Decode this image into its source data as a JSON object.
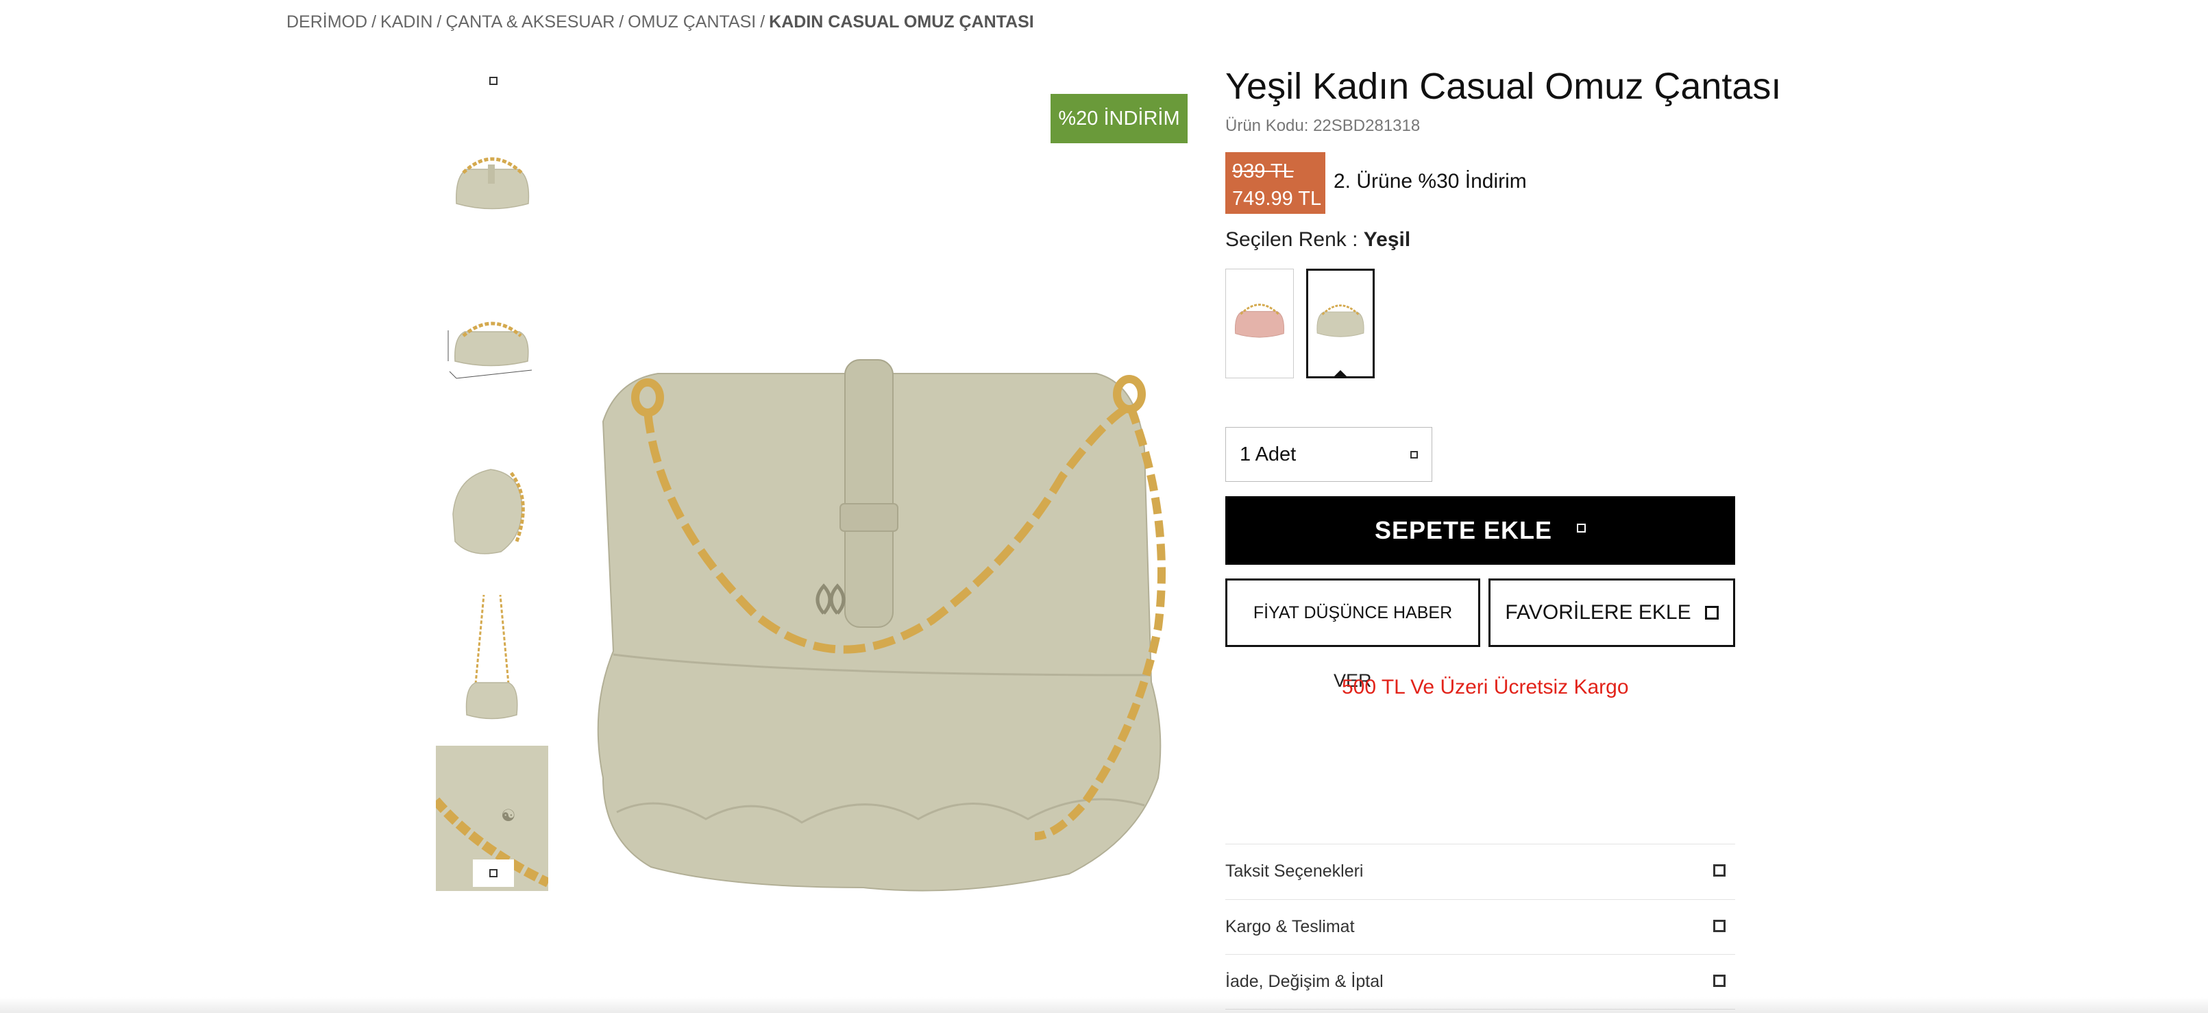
{
  "breadcrumb": {
    "items": [
      "DERİMOD",
      "KADIN",
      "ÇANTA & AKSESUAR",
      "OMUZ ÇANTASI"
    ],
    "current": "KADIN CASUAL OMUZ ÇANTASI",
    "separator": "/"
  },
  "gallery": {
    "thumbnails": [
      "front",
      "dimensions",
      "side",
      "strap",
      "detail"
    ],
    "discount_badge": "%20 İNDİRİM"
  },
  "product": {
    "title": "Yeşil Kadın Casual Omuz Çantası",
    "code": "Ürün Kodu: 22SBD281318",
    "old_price": "939 TL",
    "new_price": "749.99 TL",
    "promo": "2. Ürüne %30 İndirim",
    "color_label": "Seçilen Renk :",
    "selected_color": "Yeşil",
    "swatches": [
      "pink",
      "green"
    ],
    "quantity": "1 Adet",
    "add_to_cart": "SEPETE EKLE",
    "price_alert": "FİYAT DÜŞÜNCE HABER",
    "price_alert_overflow": "VER",
    "favorites": "FAVORİLERE EKLE",
    "shipping_note": "500 TL Ve Üzeri Ücretsiz Kargo"
  },
  "accordion": {
    "items": [
      "Taksit Seçenekleri",
      "Kargo & Teslimat",
      "İade, Değişim & İptal"
    ]
  },
  "colors": {
    "badge_green": "#6a9a3a",
    "price_orange": "#cf6a3f",
    "shipping_red": "#e2231a",
    "bag_green": "#cfcdb6",
    "bag_pink": "#e4b3aa",
    "chain_gold": "#d4a94e"
  }
}
